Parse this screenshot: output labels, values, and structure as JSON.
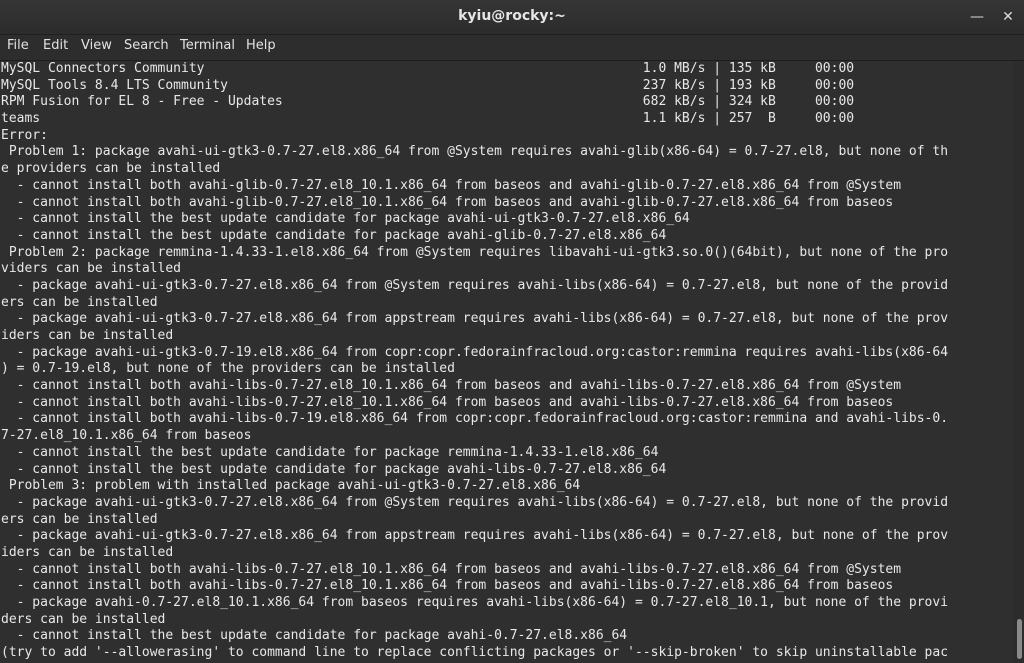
{
  "window": {
    "title": "kyiu@rocky:~",
    "minimize_icon": "minimize-icon",
    "close_icon": "close-icon"
  },
  "menu": {
    "items": [
      "File",
      "Edit",
      "View",
      "Search",
      "Terminal",
      "Help"
    ]
  },
  "terminal": {
    "lines": [
      "MySQL Connectors Community                                                        1.0 MB/s | 135 kB     00:00",
      "MySQL Tools 8.4 LTS Community                                                     237 kB/s | 193 kB     00:00",
      "RPM Fusion for EL 8 - Free - Updates                                              682 kB/s | 324 kB     00:00",
      "teams                                                                             1.1 kB/s | 257  B     00:00",
      "Error:",
      " Problem 1: package avahi-ui-gtk3-0.7-27.el8.x86_64 from @System requires avahi-glib(x86-64) = 0.7-27.el8, but none of th",
      "e providers can be installed",
      "  - cannot install both avahi-glib-0.7-27.el8_10.1.x86_64 from baseos and avahi-glib-0.7-27.el8.x86_64 from @System",
      "  - cannot install both avahi-glib-0.7-27.el8_10.1.x86_64 from baseos and avahi-glib-0.7-27.el8.x86_64 from baseos",
      "  - cannot install the best update candidate for package avahi-ui-gtk3-0.7-27.el8.x86_64",
      "  - cannot install the best update candidate for package avahi-glib-0.7-27.el8.x86_64",
      " Problem 2: package remmina-1.4.33-1.el8.x86_64 from @System requires libavahi-ui-gtk3.so.0()(64bit), but none of the pro",
      "viders can be installed",
      "  - package avahi-ui-gtk3-0.7-27.el8.x86_64 from @System requires avahi-libs(x86-64) = 0.7-27.el8, but none of the provid",
      "ers can be installed",
      "  - package avahi-ui-gtk3-0.7-27.el8.x86_64 from appstream requires avahi-libs(x86-64) = 0.7-27.el8, but none of the prov",
      "iders can be installed",
      "  - package avahi-ui-gtk3-0.7-19.el8.x86_64 from copr:copr.fedorainfracloud.org:castor:remmina requires avahi-libs(x86-64",
      ") = 0.7-19.el8, but none of the providers can be installed",
      "  - cannot install both avahi-libs-0.7-27.el8_10.1.x86_64 from baseos and avahi-libs-0.7-27.el8.x86_64 from @System",
      "  - cannot install both avahi-libs-0.7-27.el8_10.1.x86_64 from baseos and avahi-libs-0.7-27.el8.x86_64 from baseos",
      "  - cannot install both avahi-libs-0.7-19.el8.x86_64 from copr:copr.fedorainfracloud.org:castor:remmina and avahi-libs-0.",
      "7-27.el8_10.1.x86_64 from baseos",
      "  - cannot install the best update candidate for package remmina-1.4.33-1.el8.x86_64",
      "  - cannot install the best update candidate for package avahi-libs-0.7-27.el8.x86_64",
      " Problem 3: problem with installed package avahi-ui-gtk3-0.7-27.el8.x86_64",
      "  - package avahi-ui-gtk3-0.7-27.el8.x86_64 from @System requires avahi-libs(x86-64) = 0.7-27.el8, but none of the provid",
      "ers can be installed",
      "  - package avahi-ui-gtk3-0.7-27.el8.x86_64 from appstream requires avahi-libs(x86-64) = 0.7-27.el8, but none of the prov",
      "iders can be installed",
      "  - cannot install both avahi-libs-0.7-27.el8_10.1.x86_64 from baseos and avahi-libs-0.7-27.el8.x86_64 from @System",
      "  - cannot install both avahi-libs-0.7-27.el8_10.1.x86_64 from baseos and avahi-libs-0.7-27.el8.x86_64 from baseos",
      "  - package avahi-0.7-27.el8_10.1.x86_64 from baseos requires avahi-libs(x86-64) = 0.7-27.el8_10.1, but none of the provi",
      "ders can be installed",
      "  - cannot install the best update candidate for package avahi-0.7-27.el8.x86_64",
      "(try to add '--allowerasing' to command line to replace conflicting packages or '--skip-broken' to skip uninstallable pac"
    ]
  }
}
